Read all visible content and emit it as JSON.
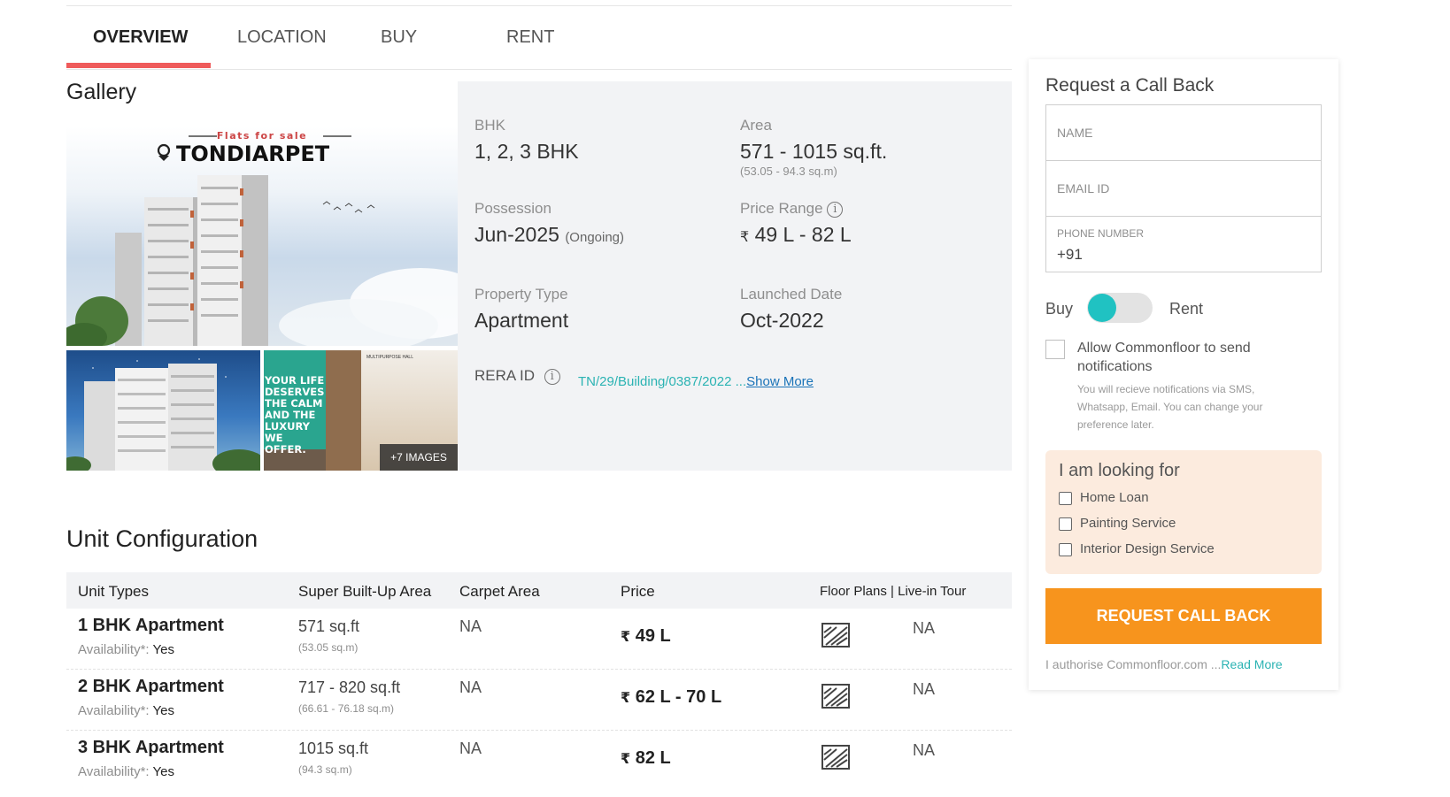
{
  "tabs": [
    {
      "label": "OVERVIEW",
      "active": true
    },
    {
      "label": "LOCATION",
      "active": false
    },
    {
      "label": "BUY",
      "active": false
    },
    {
      "label": "RENT",
      "active": false
    }
  ],
  "gallery": {
    "title": "Gallery",
    "main_banner_small": "Flats for sale",
    "main_banner_big": "TONDIARPET",
    "sub2_text": "YOUR LIFE DESERVES THE CALM AND THE LUXURY WE OFFER.",
    "sub2_sign": "MULTIPURPOSE HALL",
    "more_images": "+7 IMAGES"
  },
  "details": {
    "bhk_label": "BHK",
    "bhk_value": "1, 2, 3 BHK",
    "area_label": "Area",
    "area_value": "571 - 1015 sq.ft.",
    "area_sub": "(53.05 - 94.3 sq.m)",
    "possession_label": "Possession",
    "possession_value": "Jun-2025",
    "possession_status": "(Ongoing)",
    "price_label": "Price Range",
    "price_value": "49 L - 82 L",
    "property_type_label": "Property Type",
    "property_type_value": "Apartment",
    "launched_label": "Launched Date",
    "launched_value": "Oct-2022",
    "rera_label": "RERA ID",
    "rera_value": "TN/29/Building/0387/2022 ...",
    "rera_more": "Show More",
    "currency_symbol": "₹"
  },
  "unit_config": {
    "title": "Unit Configuration",
    "headers": [
      "Unit Types",
      "Super Built-Up Area",
      "Carpet Area",
      "Price",
      "Floor Plans | Live-in Tour"
    ],
    "rows": [
      {
        "type": "1 BHK Apartment",
        "availability_label": "Availability*:",
        "availability": "Yes",
        "area": "571 sq.ft",
        "area_sub": "(53.05 sq.m)",
        "carpet": "NA",
        "price": "49 L",
        "tour": "NA"
      },
      {
        "type": "2 BHK Apartment",
        "availability_label": "Availability*:",
        "availability": "Yes",
        "area": "717 - 820 sq.ft",
        "area_sub": "(66.61 - 76.18 sq.m)",
        "carpet": "NA",
        "price": "62 L - 70 L",
        "tour": "NA"
      },
      {
        "type": "3 BHK Apartment",
        "availability_label": "Availability*:",
        "availability": "Yes",
        "area": "1015 sq.ft",
        "area_sub": "(94.3 sq.m)",
        "carpet": "NA",
        "price": "82 L",
        "tour": "NA"
      }
    ]
  },
  "form": {
    "title": "Request a Call Back",
    "name_placeholder": "NAME",
    "email_placeholder": "EMAIL ID",
    "phone_label": "PHONE NUMBER",
    "phone_prefix": "+91",
    "toggle_left": "Buy",
    "toggle_right": "Rent",
    "allow_text": "Allow Commonfloor to send notifications",
    "allow_note": "You will recieve notifications via SMS, Whatsapp, Email. You can change your preference later.",
    "looking_title": "I am looking for",
    "looking_options": [
      "Home Loan",
      "Painting Service",
      "Interior Design Service"
    ],
    "cta": "REQUEST CALL BACK",
    "authorise_text": "I authorise Commonfloor.com ...",
    "authorise_link": "Read More"
  },
  "colors": {
    "tab_accent": "#ef5b5b",
    "teal": "#20c2c2",
    "cta_orange": "#f7941d",
    "looking_bg": "#fcebde"
  }
}
